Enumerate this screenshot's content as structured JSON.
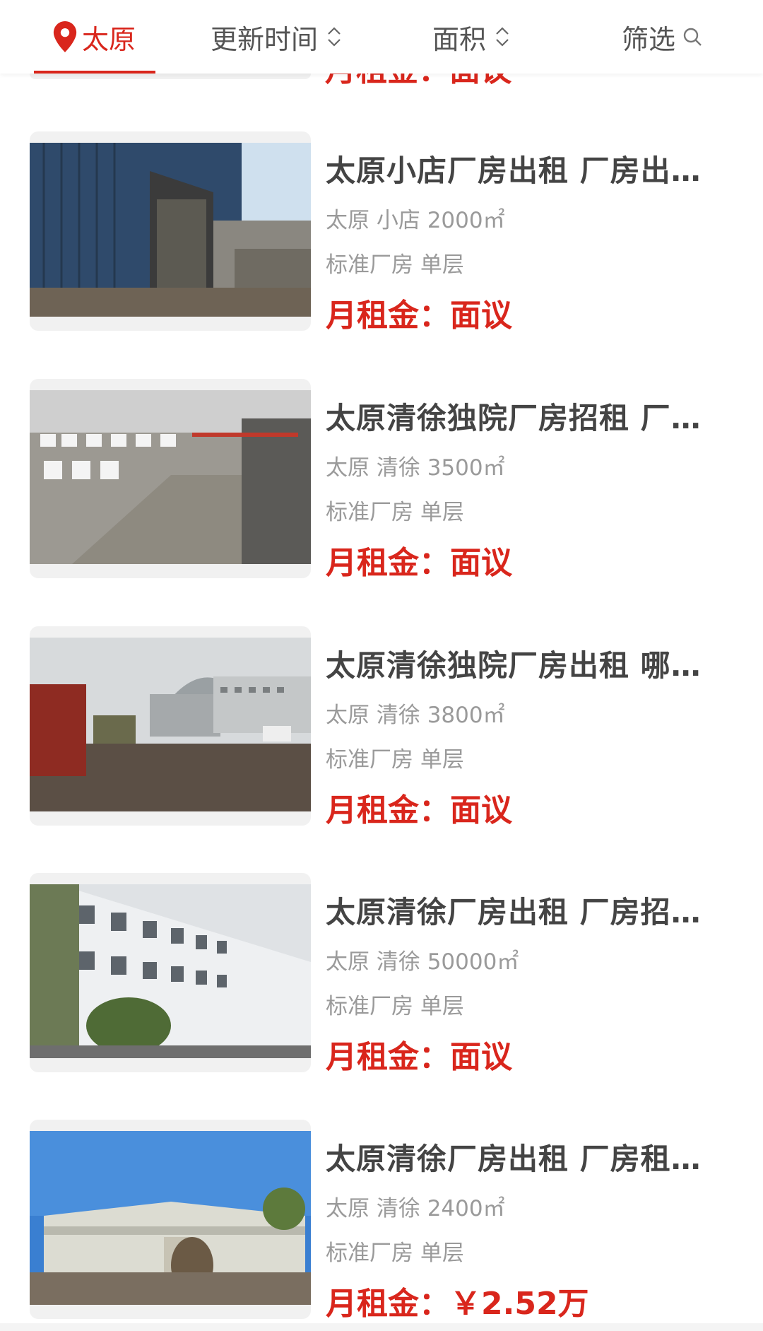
{
  "topbar": {
    "city": "太原",
    "sort_time": "更新时间",
    "sort_area": "面积",
    "filter": "筛选",
    "icons": {
      "city": "location-pin-icon",
      "sort": "sort-updown-icon",
      "filter": "search-icon"
    },
    "accent_color": "#d9261c"
  },
  "peek_item": {
    "price": "月租金：面议"
  },
  "listings": [
    {
      "title": "太原小店厂房出租 厂房出…",
      "location": "太原 小店 2000㎡",
      "tags": "标准厂房 单层",
      "price": "月租金：面议"
    },
    {
      "title": "太原清徐独院厂房招租 厂…",
      "location": "太原 清徐 3500㎡",
      "tags": "标准厂房 单层",
      "price": "月租金：面议"
    },
    {
      "title": "太原清徐独院厂房出租 哪…",
      "location": "太原 清徐 3800㎡",
      "tags": "标准厂房 单层",
      "price": "月租金：面议"
    },
    {
      "title": "太原清徐厂房出租 厂房招…",
      "location": "太原 清徐 50000㎡",
      "tags": "标准厂房 单层",
      "price": "月租金：面议"
    },
    {
      "title": "太原清徐厂房出租 厂房租…",
      "location": "太原 清徐 2400㎡",
      "tags": "标准厂房 单层",
      "price": "月租金：￥2.52万"
    }
  ]
}
